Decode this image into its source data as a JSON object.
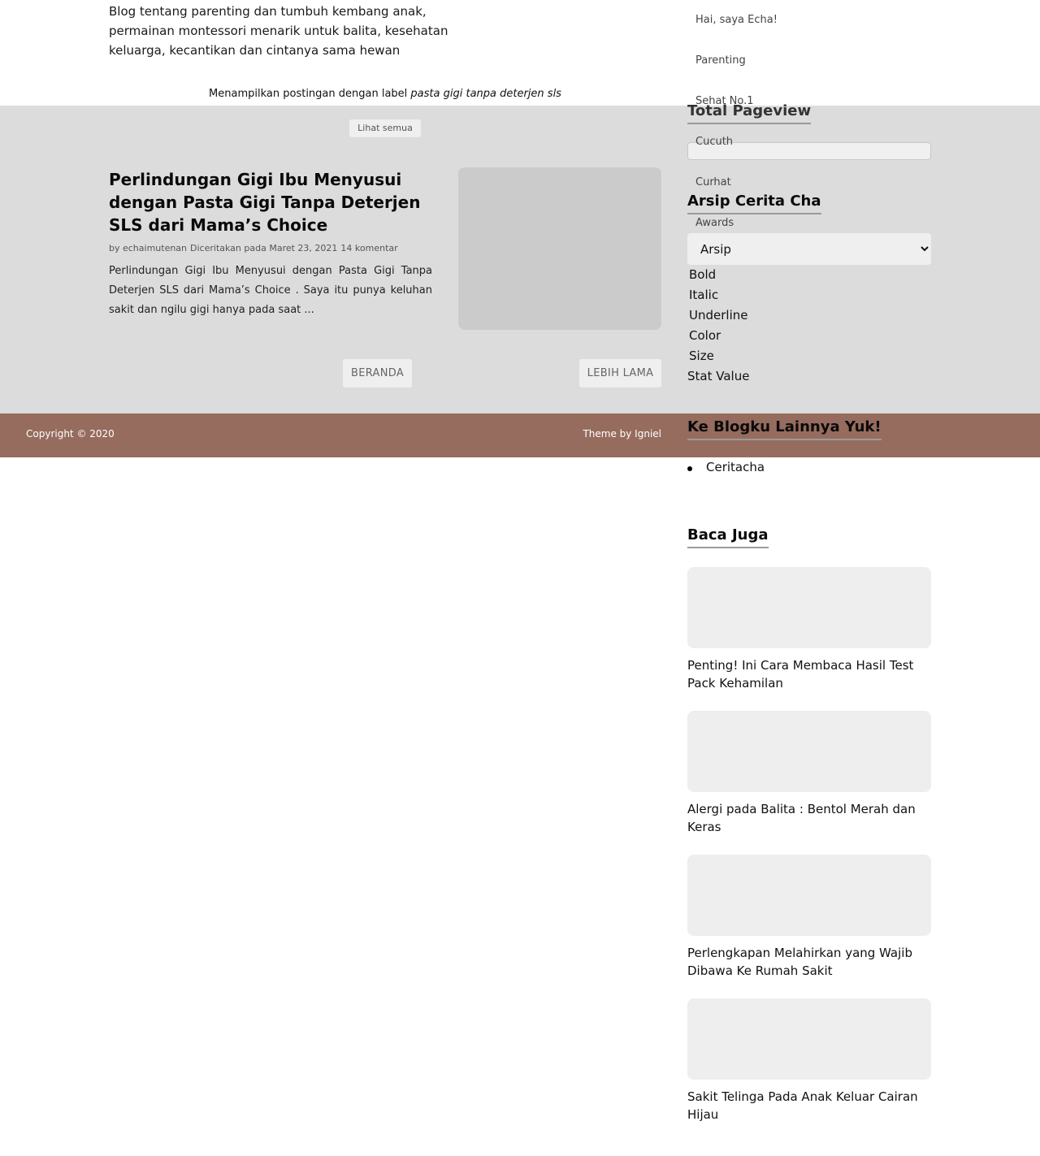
{
  "header": {
    "description": "Blog tentang parenting dan tumbuh kembang anak, permainan montessori menarik untuk balita, kesehatan keluarga, kecantikan dan cintanya sama hewan"
  },
  "main": {
    "label_notice_prefix": "Menampilkan postingan dengan label ",
    "label_name": "pasta gigi tanpa deterjen sls",
    "see_all": "Lihat semua",
    "post": {
      "title": "Perlindungan Gigi Ibu Menyusui dengan Pasta Gigi Tanpa Deterjen SLS dari Mama’s Choice",
      "meta": {
        "author": "by echaimutenan",
        "date": "Diceritakan pada Maret 23, 2021",
        "comments": "14 komentar"
      },
      "excerpt": "Perlindungan Gigi Ibu Menyusui dengan Pasta Gigi Tanpa Deterjen SLS dari Mama’s Choice . Saya itu punya keluhan sakit dan ngilu gigi hanya pada saat ..."
    },
    "pager": {
      "home": "BERANDA",
      "older": "LEBIH LAMA"
    }
  },
  "footer": {
    "copyright": "Copyright © 2020",
    "theme": "Theme by Igniel"
  },
  "sidebar": {
    "nav": [
      "Hai, saya Echa!",
      "Parenting",
      "Sehat No.1",
      "Cucuth",
      "Curhat",
      "Awards"
    ],
    "pageview_title": "Total Pageview",
    "archive_title": "Arsip Cerita Cha",
    "archive_selected": "Arsip",
    "style_options": [
      "Bold",
      "Italic",
      "Underline",
      "Color",
      "Size"
    ],
    "stat_value": "Stat Value",
    "blogs_title": "Ke Blogku Lainnya Yuk!",
    "blogs": [
      "Ceritacha"
    ],
    "read_title": "Baca Juga",
    "related": [
      "Penting! Ini Cara Membaca Hasil Test Pack Kehamilan",
      "Alergi pada Balita : Bentol Merah dan Keras",
      "Perlengkapan Melahirkan yang Wajib Dibawa Ke Rumah Sakit",
      "Sakit Telinga Pada Anak Keluar Cairan Hijau"
    ]
  },
  "colors": {
    "band": "#dcdcdc",
    "footer": "#966c5e",
    "thumb": "#cbcbcb"
  }
}
